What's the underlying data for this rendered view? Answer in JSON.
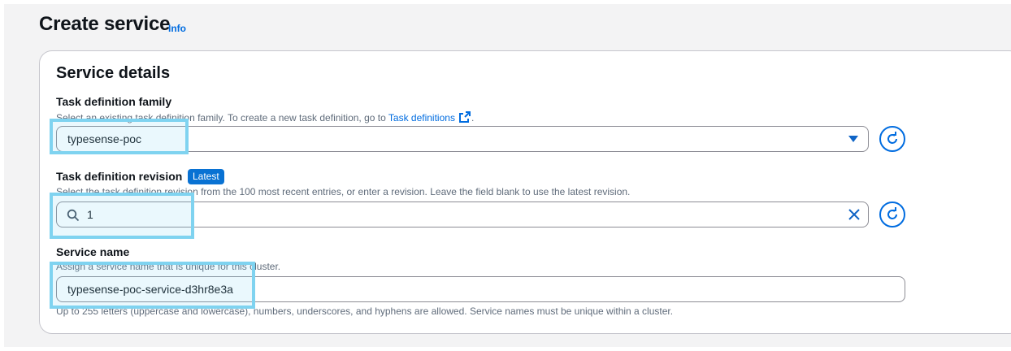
{
  "header": {
    "title": "Create service",
    "info_link": "Info"
  },
  "service_details": {
    "title": "Service details",
    "task_definition_family": {
      "label": "Task definition family",
      "description_prefix": "Select an existing task definition family. To create a new task definition, go to ",
      "description_link": "Task definitions",
      "description_suffix": ".",
      "value": "typesense-poc"
    },
    "task_definition_revision": {
      "label": "Task definition revision",
      "badge": "Latest",
      "description": "Select the task definition revision from the 100 most recent entries, or enter a revision. Leave the field blank to use the latest revision.",
      "value": "1"
    },
    "service_name": {
      "label": "Service name",
      "description": "Assign a service name that is unique for this cluster.",
      "value": "typesense-poc-service-d3hr8e3a",
      "constraint": "Up to 255 letters (uppercase and lowercase), numbers, underscores, and hyphens are allowed. Service names must be unique within a cluster."
    }
  },
  "colors": {
    "accent": "#006ce0",
    "badge": "#0972d3",
    "highlight": "#7fd3f0",
    "border": "#8c8c94",
    "muted_text": "#5f6b7a"
  },
  "icons": {
    "external": "external-link-icon",
    "dropdown": "caret-down-icon",
    "refresh": "refresh-icon",
    "search": "search-icon",
    "clear": "close-icon"
  }
}
